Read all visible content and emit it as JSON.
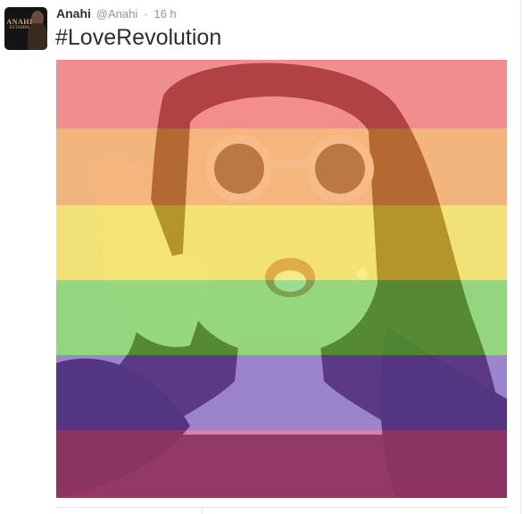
{
  "tweet": {
    "author_name": "Anahi",
    "author_handle": "@Anahi",
    "separator": "·",
    "timestamp": "16 h",
    "text": "#LoveRevolution",
    "avatar_logo_text": "ANAHI",
    "avatar_logo_subtext": "ESTAMPA"
  },
  "photo": {
    "overlay_colors": [
      "#f24a5e",
      "#f7963e",
      "#f5ea2f",
      "#41d33f",
      "#4d3bd8",
      "#b93aa2"
    ]
  },
  "colors": {
    "text_primary": "#292f33",
    "text_secondary": "#8899a6",
    "divider": "#e1e8ed"
  }
}
